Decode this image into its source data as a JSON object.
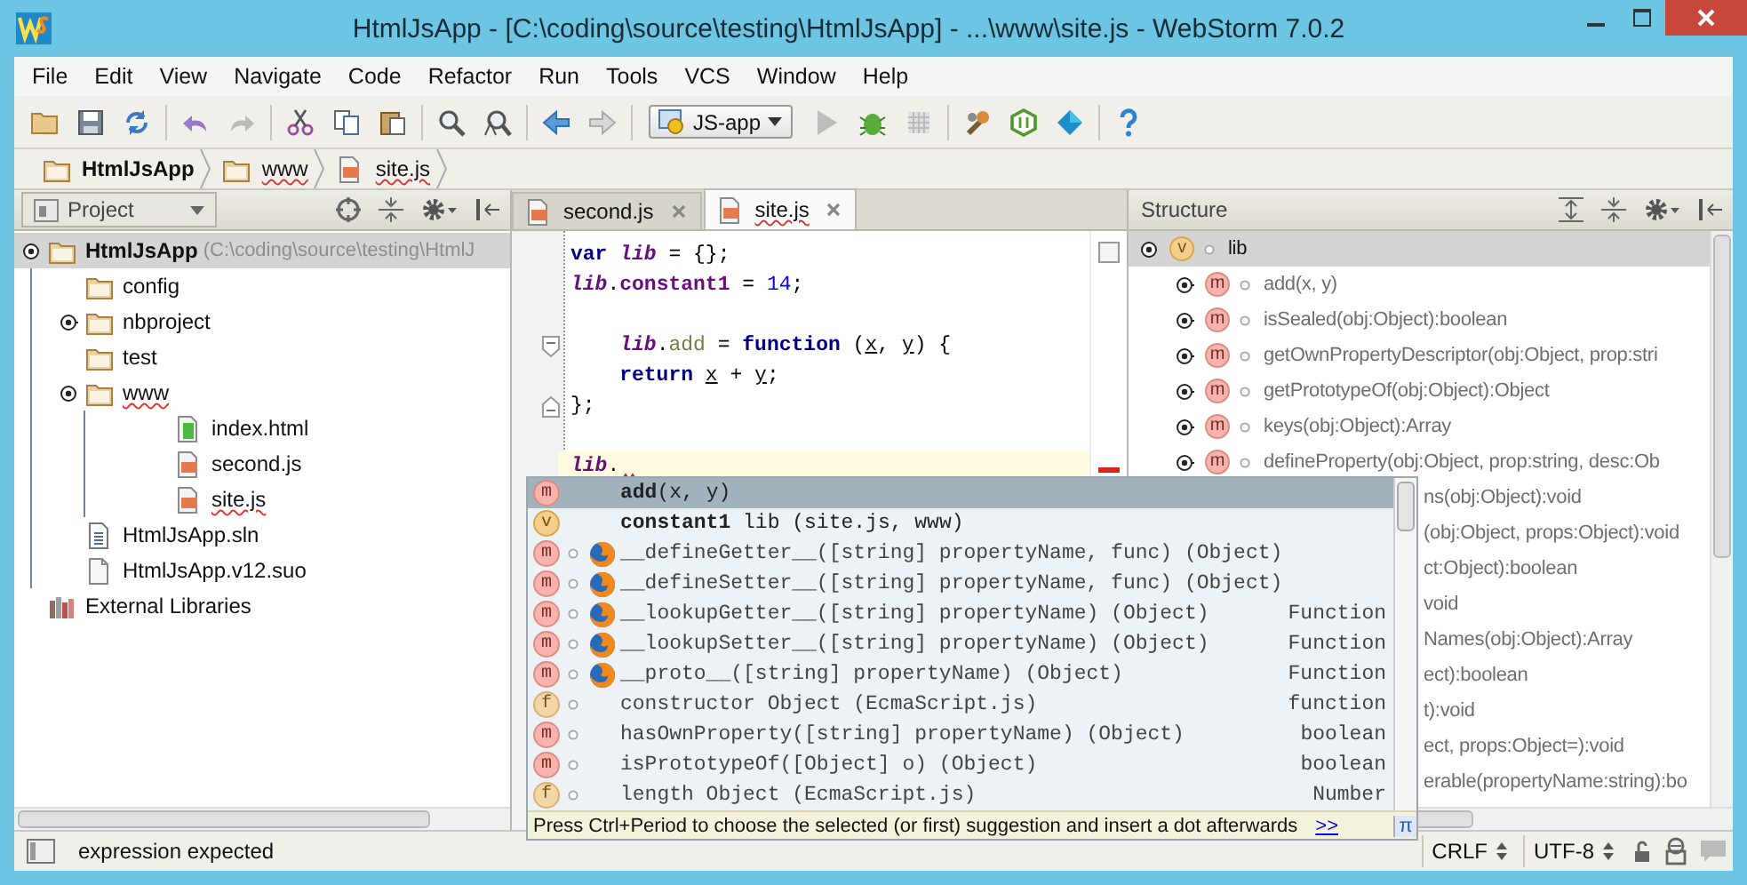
{
  "window": {
    "title": "HtmlJsApp - [C:\\coding\\source\\testing\\HtmlJsApp] - ...\\www\\site.js - WebStorm 7.0.2"
  },
  "menu": [
    "File",
    "Edit",
    "View",
    "Navigate",
    "Code",
    "Refactor",
    "Run",
    "Tools",
    "VCS",
    "Window",
    "Help"
  ],
  "toolbar": {
    "run_config": "JS-app"
  },
  "breadcrumbs": [
    {
      "label": "HtmlJsApp",
      "kind": "folder",
      "misspelled": false
    },
    {
      "label": "www",
      "kind": "folder",
      "misspelled": true
    },
    {
      "label": "site.js",
      "kind": "js",
      "misspelled": true
    }
  ],
  "project_panel": {
    "title": "Project",
    "tree": [
      {
        "label": "HtmlJsApp",
        "hint": "(C:\\coding\\source\\testing\\HtmlJ",
        "kind": "folder",
        "selected": true,
        "expanded": true,
        "misspelled": false,
        "children": [
          {
            "label": "config",
            "kind": "folder",
            "selected": false,
            "misspelled": false
          },
          {
            "label": "nbproject",
            "kind": "folder",
            "selected": false,
            "expanded": false,
            "misspelled": false
          },
          {
            "label": "test",
            "kind": "folder",
            "selected": false,
            "misspelled": false
          },
          {
            "label": "www",
            "kind": "folder",
            "selected": false,
            "expanded": true,
            "misspelled": true,
            "children": [
              {
                "label": "index.html",
                "kind": "html",
                "selected": false,
                "misspelled": false
              },
              {
                "label": "second.js",
                "kind": "js",
                "selected": false,
                "misspelled": false
              },
              {
                "label": "site.js",
                "kind": "js",
                "selected": false,
                "misspelled": true
              }
            ]
          },
          {
            "label": "HtmlJsApp.sln",
            "kind": "sln",
            "selected": false,
            "misspelled": false
          },
          {
            "label": "HtmlJsApp.v12.suo",
            "kind": "file",
            "selected": false,
            "misspelled": false
          }
        ]
      },
      {
        "label": "External Libraries",
        "kind": "library",
        "selected": false,
        "misspelled": false
      }
    ]
  },
  "editor": {
    "tabs": [
      {
        "label": "second.js",
        "selected": false,
        "misspelled": false
      },
      {
        "label": "site.js",
        "selected": true,
        "misspelled": true
      }
    ],
    "lines": [
      {
        "kind": "code",
        "current": false,
        "tokens": [
          {
            "kind": "keyword",
            "text": "var "
          },
          {
            "kind": "global",
            "text": "lib"
          },
          {
            "kind": "plain",
            "text": " = {};"
          }
        ]
      },
      {
        "kind": "code",
        "current": false,
        "tokens": [
          {
            "kind": "global",
            "text": "lib"
          },
          {
            "kind": "plain",
            "text": "."
          },
          {
            "kind": "field",
            "text": "constant1"
          },
          {
            "kind": "plain",
            "text": " = "
          },
          {
            "kind": "number",
            "text": "14"
          },
          {
            "kind": "plain",
            "text": ";"
          }
        ]
      },
      {
        "kind": "blank"
      },
      {
        "kind": "fold_start",
        "current": false,
        "tokens": [
          {
            "kind": "global",
            "text": "    lib"
          },
          {
            "kind": "plain",
            "text": "."
          },
          {
            "kind": "method",
            "text": "add"
          },
          {
            "kind": "plain",
            "text": " = "
          },
          {
            "kind": "keyword",
            "text": "function"
          },
          {
            "kind": "plain",
            "text": " ("
          },
          {
            "kind": "param",
            "text": "x"
          },
          {
            "kind": "plain",
            "text": ", "
          },
          {
            "kind": "param",
            "text": "y"
          },
          {
            "kind": "plain",
            "text": ") {"
          }
        ]
      },
      {
        "kind": "code",
        "current": false,
        "tokens": [
          {
            "kind": "keyword",
            "text": "    return "
          },
          {
            "kind": "param",
            "text": "x"
          },
          {
            "kind": "plain",
            "text": " + "
          },
          {
            "kind": "param",
            "text": "y"
          },
          {
            "kind": "plain",
            "text": ";"
          }
        ]
      },
      {
        "kind": "fold_end",
        "current": false,
        "tokens": [
          {
            "kind": "plain",
            "text": "};"
          }
        ]
      },
      {
        "kind": "blank"
      },
      {
        "kind": "code",
        "current": true,
        "tokens": [
          {
            "kind": "global",
            "text": "lib"
          },
          {
            "kind": "plain",
            "text": "."
          }
        ]
      }
    ]
  },
  "completion": {
    "items": [
      {
        "badge": "m",
        "kind": "own",
        "browser": false,
        "text": "**add**(x, y)",
        "selected": true
      },
      {
        "badge": "v",
        "kind": "own",
        "browser": false,
        "text": "**constant1** lib (site.js, www)",
        "selected": false
      },
      {
        "badge": "m",
        "kind": "builtin",
        "browser": true,
        "text": "__defineGetter__([string] propertyName, func) (Object)",
        "selected": false
      },
      {
        "badge": "m",
        "kind": "builtin",
        "browser": true,
        "text": "__defineSetter__([string] propertyName, func) (Object)",
        "selected": false
      },
      {
        "badge": "m",
        "kind": "builtin",
        "browser": true,
        "text": "__lookupGetter__([string] propertyName) (Object)",
        "type": "Function",
        "selected": false
      },
      {
        "badge": "m",
        "kind": "builtin",
        "browser": true,
        "text": "__lookupSetter__([string] propertyName) (Object)",
        "type": "Function",
        "selected": false
      },
      {
        "badge": "m",
        "kind": "builtin",
        "browser": true,
        "text": "__proto__([string] propertyName) (Object)",
        "type": "Function",
        "selected": false
      },
      {
        "badge": "f",
        "kind": "builtin",
        "browser": false,
        "text": "constructor Object (EcmaScript.js)",
        "type": "function",
        "selected": false
      },
      {
        "badge": "m",
        "kind": "builtin",
        "browser": false,
        "text": "hasOwnProperty([string] propertyName) (Object)",
        "type": "boolean",
        "selected": false
      },
      {
        "badge": "m",
        "kind": "builtin",
        "browser": false,
        "text": "isPrototypeOf([Object] o) (Object)",
        "type": "boolean",
        "selected": false
      },
      {
        "badge": "f",
        "kind": "builtin",
        "browser": false,
        "text": "length Object (EcmaScript.js)",
        "type": "Number",
        "selected": false
      }
    ],
    "hint": "Press Ctrl+Period to choose the selected (or first) suggestion and insert a dot afterwards",
    "hint_link": ">>",
    "pi_button": "π"
  },
  "structure_panel": {
    "title": "Structure",
    "tree": [
      {
        "label": "lib",
        "badge": "v",
        "selected": true,
        "expanded": true,
        "children": [
          {
            "label": "add(x, y)",
            "badge": "m",
            "kind": "own",
            "selected": false
          },
          {
            "label": "isSealed(obj:Object):boolean",
            "badge": "m",
            "kind": "inherited",
            "selected": false
          },
          {
            "label": "getOwnPropertyDescriptor(obj:Object, prop:stri",
            "badge": "m",
            "kind": "inherited",
            "selected": false
          },
          {
            "label": "getPrototypeOf(obj:Object):Object",
            "badge": "m",
            "kind": "inherited",
            "selected": false
          },
          {
            "label": "keys(obj:Object):Array",
            "badge": "m",
            "kind": "inherited",
            "selected": false
          },
          {
            "label": "defineProperty(obj:Object, prop:string, desc:Ob",
            "badge": "m",
            "kind": "inherited",
            "selected": false
          },
          {
            "label": "ns(obj:Object):void",
            "kind": "covered",
            "selected": false
          },
          {
            "label": "(obj:Object, props:Object):void",
            "kind": "covered",
            "selected": false
          },
          {
            "label": "ct:Object):boolean",
            "kind": "covered",
            "selected": false
          },
          {
            "label": "void",
            "kind": "covered",
            "selected": false
          },
          {
            "label": "Names(obj:Object):Array",
            "kind": "covered",
            "selected": false
          },
          {
            "label": "ect):boolean",
            "kind": "covered",
            "selected": false
          },
          {
            "label": "t):void",
            "kind": "covered",
            "selected": false
          },
          {
            "label": "ect, props:Object=):void",
            "kind": "covered",
            "selected": false
          },
          {
            "label": "erable(propertyName:string):bo",
            "kind": "covered",
            "selected": false
          }
        ]
      }
    ]
  },
  "status_bar": {
    "message": "expression expected",
    "line_separator": "CRLF",
    "encoding": "UTF-8"
  }
}
